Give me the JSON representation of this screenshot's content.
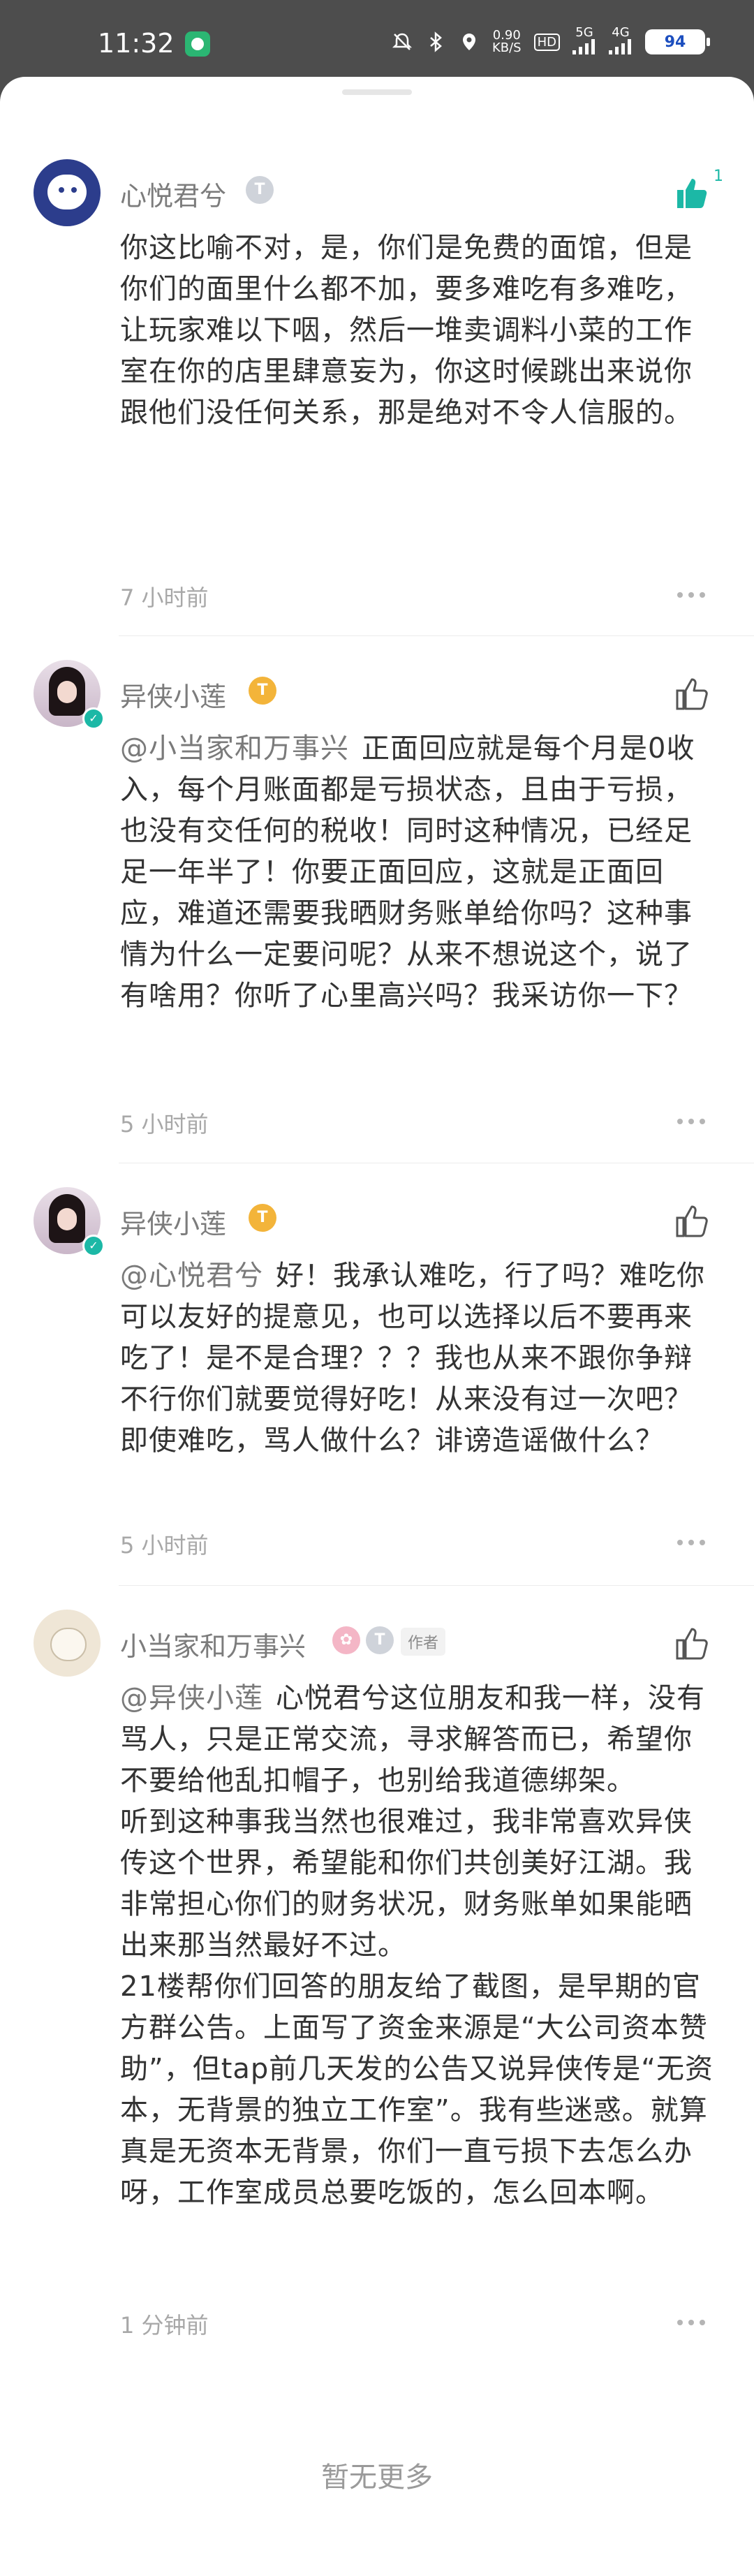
{
  "status_bar": {
    "time": "11:32",
    "net_speed_value": "0.90",
    "net_speed_unit": "KB/S",
    "hd_label": "HD",
    "signal_1_label": "5G",
    "signal_2_label": "4G",
    "battery": "94"
  },
  "comments": [
    {
      "author": "心悦君兮",
      "badge1": "T",
      "like_count": "1",
      "liked": true,
      "mention": "",
      "paragraphs": [
        "你这比喻不对，是，你们是免费的面馆，但是你们的面里什么都不加，要多难吃有多难吃，让玩家难以下咽，然后一堆卖调料小菜的工作室在你的店里肆意妄为，你这时候跳出来说你跟他们没任何关系，那是绝对不令人信服的。"
      ],
      "time": "7 小时前"
    },
    {
      "author": "异侠小莲",
      "badge1": "T",
      "like_count": "",
      "liked": false,
      "mention": "@小当家和万事兴",
      "paragraphs": [
        "正面回应就是每个月是0收入，每个月账面都是亏损状态，且由于亏损，也没有交任何的税收！同时这种情况，已经足足一年半了！你要正面回应，这就是正面回应，难道还需要我晒财务账单给你吗？这种事情为什么一定要问呢？从来不想说这个，说了有啥用？你听了心里高兴吗？我采访你一下？"
      ],
      "time": "5 小时前"
    },
    {
      "author": "异侠小莲",
      "badge1": "T",
      "like_count": "",
      "liked": false,
      "mention": "@心悦君兮",
      "paragraphs": [
        "好！我承认难吃，行了吗？难吃你可以友好的提意见，也可以选择以后不要再来吃了！是不是合理？？？我也从来不跟你争辩不行你们就要觉得好吃！从来没有过一次吧？即使难吃，骂人做什么？诽谤造谣做什么？"
      ],
      "time": "5 小时前"
    },
    {
      "author": "小当家和万事兴",
      "badge1": "T",
      "author_tag": "作者",
      "like_count": "",
      "liked": false,
      "mention": "@异侠小莲",
      "paragraphs": [
        "心悦君兮这位朋友和我一样，没有骂人，只是正常交流，寻求解答而已，希望你不要给他乱扣帽子，也别给我道德绑架。",
        "听到这种事我当然也很难过，我非常喜欢异侠传这个世界，希望能和你们共创美好江湖。我非常担心你们的财务状况，财务账单如果能晒出来那当然最好不过。",
        "21楼帮你们回答的朋友给了截图，是早期的官方群公告。上面写了资金来源是“大公司资本赞助”，但tap前几天发的公告又说异侠传是“无资本，无背景的独立工作室”。我有些迷惑。就算真是无资本无背景，你们一直亏损下去怎么办呀，工作室成员总要吃饭的，怎么回本啊。"
      ],
      "time": "1 分钟前"
    }
  ],
  "footer": {
    "no_more": "暂无更多"
  },
  "colors": {
    "accent": "#1cb8a6",
    "text": "#333333",
    "muted": "#a8a8a8"
  }
}
